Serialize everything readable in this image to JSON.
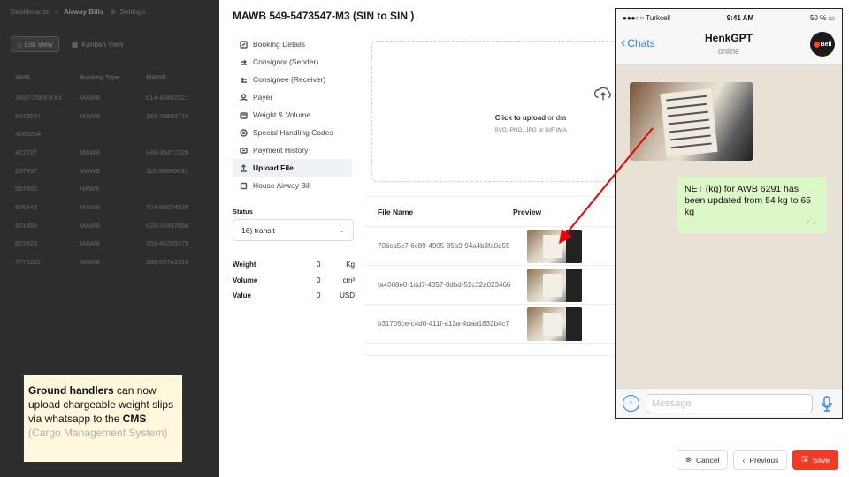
{
  "background": {
    "breadcrumbs": [
      "Dashboards",
      "Airway Bills"
    ],
    "settings_label": "Settings",
    "views": {
      "list": "List View",
      "kanban": "Kanban View"
    },
    "columns": [
      "AWB",
      "Booking Type",
      "MAWB"
    ],
    "rows": [
      [
        "3487-2569-XXX",
        "MAWB",
        "614-45892521"
      ],
      [
        "5473547",
        "MAWB",
        "192-79903774"
      ],
      [
        "4266254",
        "",
        ""
      ],
      [
        "472727",
        "MAWB",
        "946-35477220"
      ],
      [
        "267457",
        "MAWB",
        "110-98609631"
      ],
      [
        "567456",
        "HAWB",
        ""
      ],
      [
        "876543",
        "MAWB",
        "704-65024538"
      ],
      [
        "801456",
        "MAWB",
        "626-32457066"
      ],
      [
        "872323",
        "MAWB",
        "759-46205375"
      ],
      [
        "7776222",
        "MAWB",
        "286-66742316"
      ]
    ]
  },
  "callout": {
    "bold1": "Ground handlers",
    "text1": " can now upload chargeable weight slips via whatsapp to the ",
    "bold2": "CMS",
    "gray": " (Cargo Management System)"
  },
  "modal": {
    "title": "MAWB 549-5473547-M3 (SIN to SIN )",
    "nav": [
      {
        "label": "Booking Details",
        "icon": "edit-icon"
      },
      {
        "label": "Consignor (Sender)",
        "icon": "sender-icon"
      },
      {
        "label": "Consignee (Receiver)",
        "icon": "receiver-icon"
      },
      {
        "label": "Payer",
        "icon": "person-icon"
      },
      {
        "label": "Weight & Volume",
        "icon": "box-icon"
      },
      {
        "label": "Special Handling Codes",
        "icon": "tag-icon"
      },
      {
        "label": "Payment History",
        "icon": "card-icon"
      },
      {
        "label": "Upload File",
        "icon": "upload-icon"
      },
      {
        "label": "House Airway Bill",
        "icon": "checkbox-icon"
      }
    ],
    "active_nav": "Upload File",
    "status_label": "Status",
    "status_value": "16) transit",
    "stats": [
      {
        "label": "Weight",
        "value": "0",
        "unit": "Kg"
      },
      {
        "label": "Volume",
        "value": "0",
        "unit": "cm³"
      },
      {
        "label": "Value",
        "value": "0",
        "unit": "USD"
      }
    ],
    "upload": {
      "click": "Click to upload",
      "rest": " or dra",
      "formats": "SVG, PNG, JPG or GIF (MA"
    },
    "files": {
      "headers": [
        "File Name",
        "Preview"
      ],
      "rows": [
        "706ca5c7-6c89-4905-85a9-94a4b3fa0d55",
        "fa4068e0-1dd7-4357-8dbd-52c32a023466",
        "b31705ce-c4d0-411f-a13a-4daa1832b4c7"
      ]
    },
    "buttons": {
      "cancel": "Cancel",
      "previous": "Previous",
      "save": "Save"
    }
  },
  "phone": {
    "carrier": "●●●○○ Turkcell",
    "time": "9:41 AM",
    "battery": "50 %",
    "back": "Chats",
    "contact": "HenkGPT",
    "presence": "online",
    "avatar_text": "Bell",
    "message": "NET (kg) for AWB 6291 has been updated from 54 kg to 65 kg",
    "placeholder": "Message"
  },
  "colors": {
    "accent_red": "#ef3b24",
    "ios_blue": "#2f7cf6",
    "bubble_green": "#dcf8c6"
  }
}
